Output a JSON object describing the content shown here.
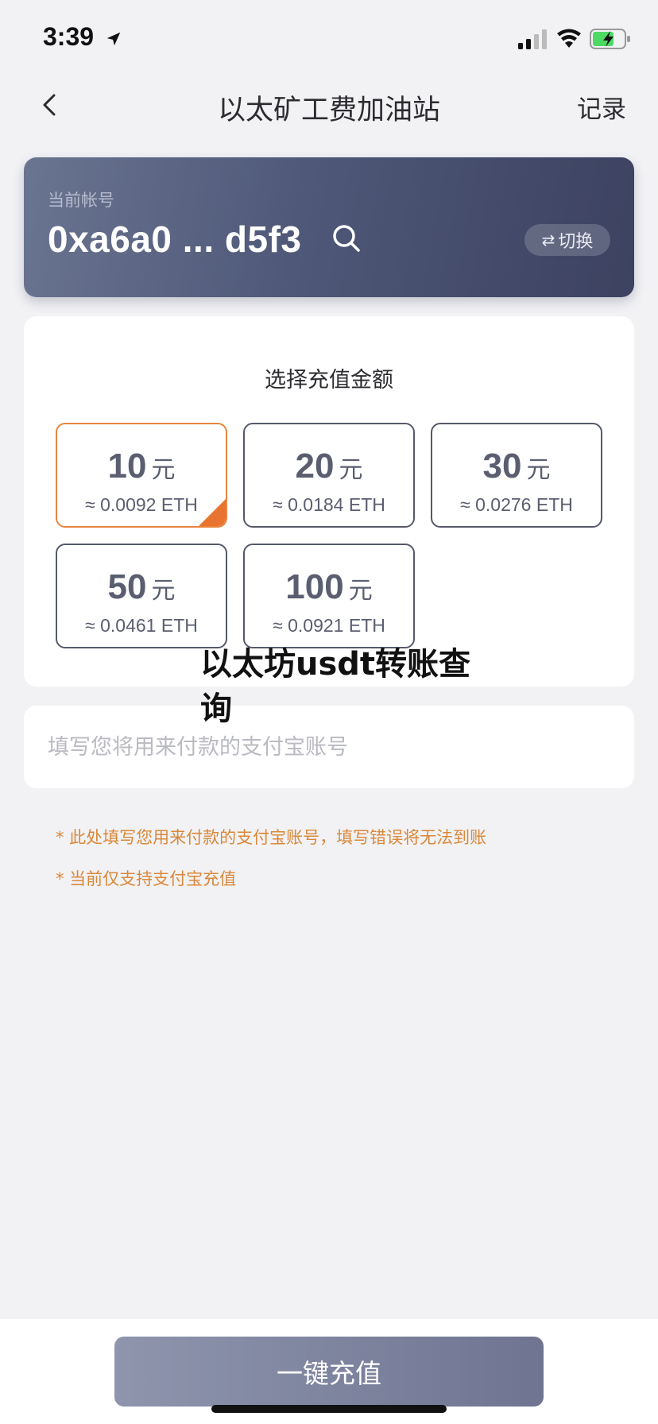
{
  "status_bar": {
    "time": "3:39",
    "icons": [
      "location-arrow-icon",
      "signal-icon",
      "wifi-icon",
      "battery-charging-icon"
    ]
  },
  "nav": {
    "back_icon": "chevron-left-icon",
    "title": "以太矿工费加油站",
    "records_label": "记录"
  },
  "account": {
    "label": "当前帐号",
    "address": "0xa6a0 ... d5f3",
    "search_icon": "search-icon",
    "switch_label": "切换",
    "switch_icon": "swap-arrows-icon"
  },
  "amount_section": {
    "title": "选择充值金额",
    "options": [
      {
        "value": "10",
        "unit": "元",
        "eth": "≈ 0.0092 ETH",
        "selected": true
      },
      {
        "value": "20",
        "unit": "元",
        "eth": "≈ 0.0184 ETH",
        "selected": false
      },
      {
        "value": "30",
        "unit": "元",
        "eth": "≈ 0.0276 ETH",
        "selected": false
      },
      {
        "value": "50",
        "unit": "元",
        "eth": "≈ 0.0461 ETH",
        "selected": false
      },
      {
        "value": "100",
        "unit": "元",
        "eth": "≈ 0.0921 ETH",
        "selected": false
      }
    ]
  },
  "overlay_text": "以太坊usdt转账查询",
  "alipay": {
    "value": "",
    "placeholder": "填写您将用来付款的支付宝账号"
  },
  "notes": [
    "* 此处填写您用来付款的支付宝账号，填写错误将无法到账",
    "* 当前仅支持支付宝充值"
  ],
  "bottom": {
    "button_label": "一键充值"
  },
  "colors": {
    "accent": "#e8853f",
    "card_gradient_start": "#6a7591",
    "card_gradient_end": "#3c4260",
    "note": "#d9883a",
    "button": "#7f86a0"
  }
}
